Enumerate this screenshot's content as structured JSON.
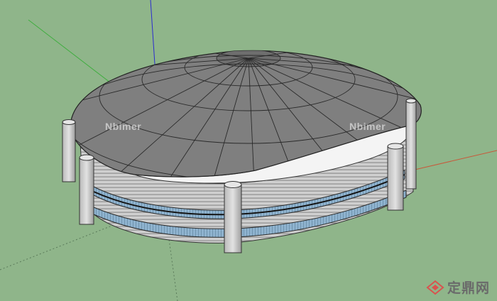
{
  "scene": {
    "description_colors": {
      "background": "#8fb58a",
      "dome_panel": "#7d7d7d",
      "dome_line": "#222222",
      "base_band": "#c8c8c8",
      "base_stripe": "#9a9a9a",
      "glass": "#8fb3cf",
      "column": "#cfcfcf"
    }
  },
  "watermarks": {
    "left": "Nbimer",
    "right": "Nbimer"
  },
  "brand": {
    "text": "定鼎网",
    "logo_icon": "diamond-logo-icon"
  }
}
